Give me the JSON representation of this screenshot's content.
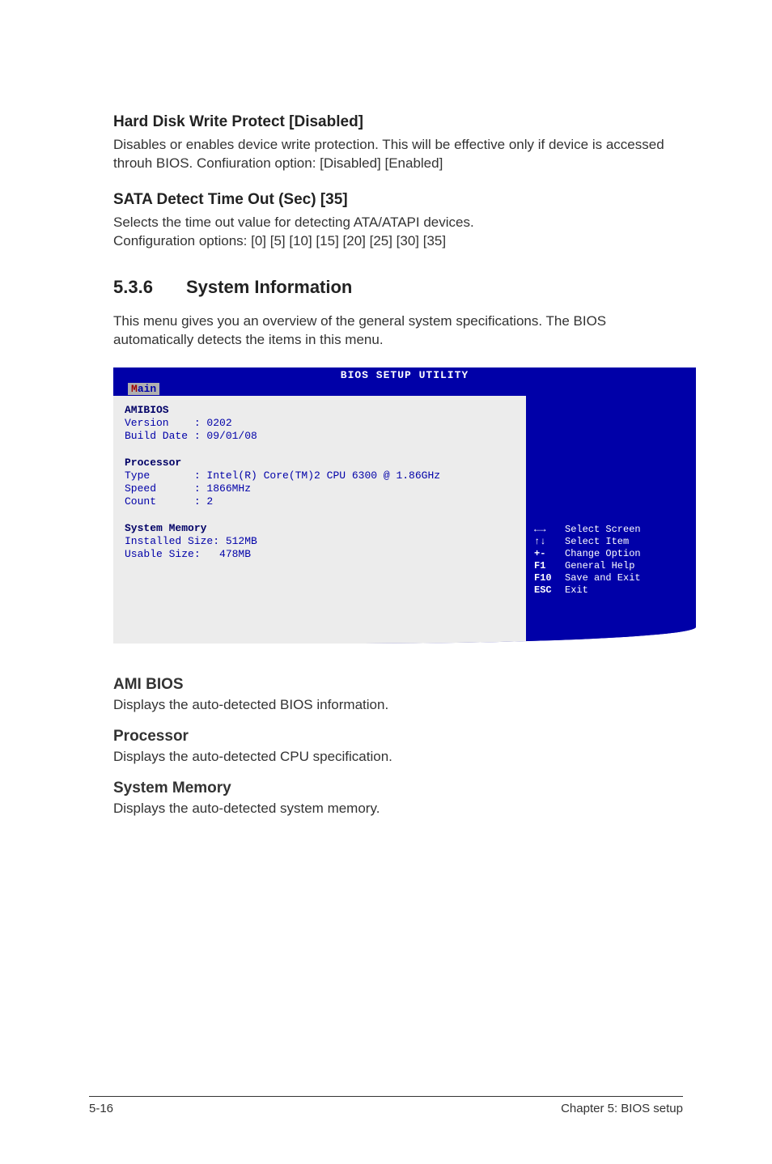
{
  "sec1": {
    "title": "Hard Disk Write Protect [Disabled]",
    "body": "Disables or enables device write protection. This will be effective only if device is accessed throuh BIOS. Confiuration option: [Disabled] [Enabled]"
  },
  "sec2": {
    "title": "SATA Detect Time Out (Sec) [35]",
    "body_l1": "Selects the time out value for detecting ATA/ATAPI devices.",
    "body_l2": "Configuration options: [0] [5] [10] [15] [20] [25] [30] [35]"
  },
  "section_heading": {
    "num": "5.3.6",
    "title": "System Information"
  },
  "section_intro": "This menu gives you an overview of the general system specifications. The BIOS automatically detects the items in this menu.",
  "bios": {
    "title": "BIOS SETUP UTILITY",
    "tab_hotkey": "M",
    "tab_rest": "ain",
    "amibios_hdr": "AMIBIOS",
    "version_line": "Version    : 0202",
    "build_line": "Build Date : 09/01/08",
    "proc_hdr": "Processor",
    "type_line": "Type       : Intel(R) Core(TM)2 CPU 6300 @ 1.86GHz",
    "speed_line": "Speed      : 1866MHz",
    "count_line": "Count      : 2",
    "mem_hdr": "System Memory",
    "installed_line": "Installed Size: 512MB",
    "usable_line": "Usable Size:   478MB",
    "help": [
      {
        "key": "←→",
        "desc": "Select Screen"
      },
      {
        "key": "↑↓",
        "desc": "Select Item"
      },
      {
        "key": "+-",
        "desc": "Change Option"
      },
      {
        "key": "F1",
        "desc": "General Help"
      },
      {
        "key": "F10",
        "desc": "Save and Exit"
      },
      {
        "key": "ESC",
        "desc": "Exit"
      }
    ]
  },
  "ami": {
    "h1": "AMI BIOS",
    "p1": "Displays the auto-detected BIOS information.",
    "h2": "Processor",
    "p2": "Displays the auto-detected CPU specification.",
    "h3": "System Memory",
    "p3": "Displays the auto-detected system memory."
  },
  "footer": {
    "left": "5-16",
    "right": "Chapter 5: BIOS setup"
  }
}
